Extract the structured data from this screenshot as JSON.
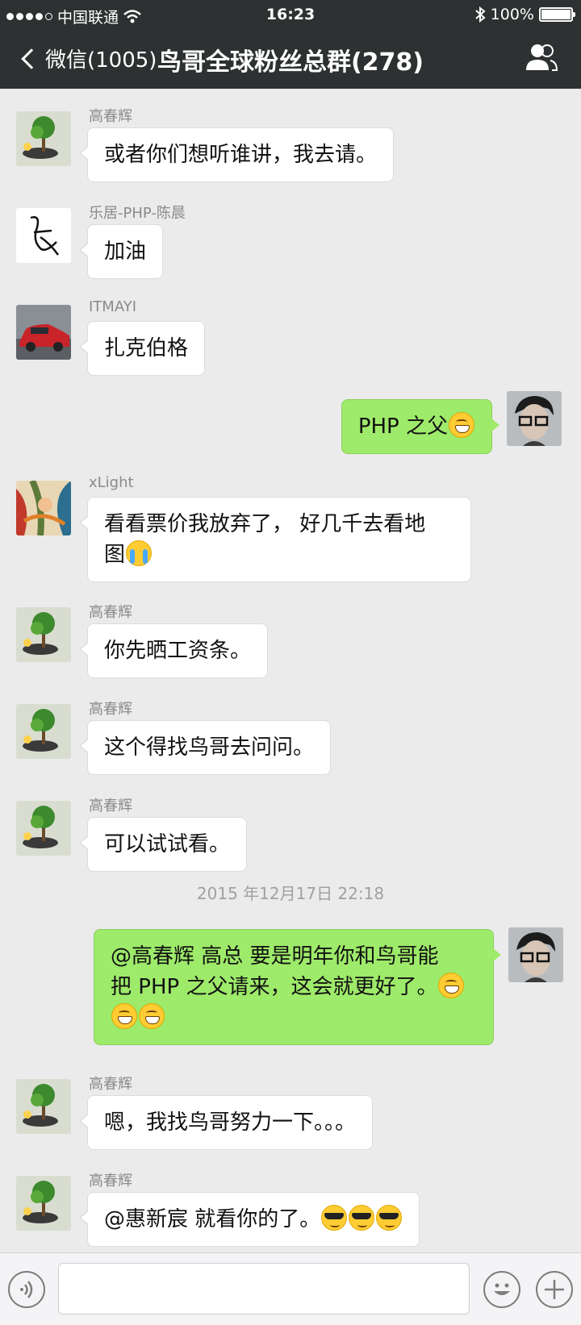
{
  "status_bar": {
    "carrier": "中国联通",
    "time": "16:23",
    "battery": "100%",
    "battery_level": 1.0
  },
  "nav": {
    "back_label": "微信(1005)",
    "title": "鸟哥全球粉丝总群(278)"
  },
  "messages": [
    {
      "sender": "高春辉",
      "text": "或者你们想听谁讲，我去请。"
    },
    {
      "sender": "乐居-PHP-陈晨",
      "text": "加油"
    },
    {
      "sender": "ITMAYI",
      "text": "扎克伯格"
    },
    {
      "sender": "",
      "text": "PHP 之父"
    },
    {
      "sender": "xLight",
      "text_line1": "看看票价我放弃了， 好几千去看地",
      "text_line2": "图"
    },
    {
      "sender": "高春辉",
      "text": "你先晒工资条。"
    },
    {
      "sender": "高春辉",
      "text": "这个得找鸟哥去问问。"
    },
    {
      "sender": "高春辉",
      "text": "可以试试看。"
    },
    {
      "timestamp": "2015 年12月17日 22:18"
    },
    {
      "sender": "",
      "text_line1": "@高春辉 高总 要是明年你和鸟哥能",
      "text_line2": "把 PHP 之父请来，这会就更好了。"
    },
    {
      "sender": "高春辉",
      "text": "嗯，我找鸟哥努力一下。。。"
    },
    {
      "sender": "高春辉",
      "text": "@惠新宸 就看你的了。"
    }
  ],
  "input": {
    "placeholder": ""
  },
  "icons": {
    "voice": "voice-icon",
    "emoji": "emoji-icon",
    "plus": "plus-icon",
    "members": "group-members-icon",
    "back": "back-chevron-icon"
  }
}
